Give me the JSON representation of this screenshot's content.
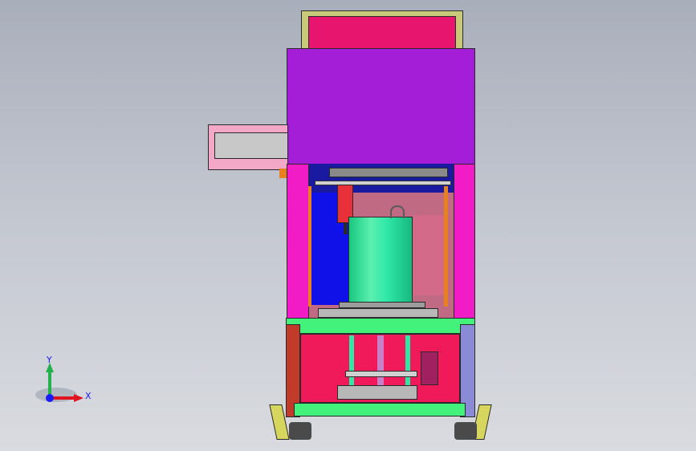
{
  "viewport": {
    "background_top": "#a9aebb",
    "background_bottom": "#d9dbe0"
  },
  "triad": {
    "x_label": "X",
    "y_label": "Y",
    "x_color": "#e0141e",
    "y_color": "#22b14c",
    "z_color": "#1a1aff"
  },
  "model": {
    "colors": {
      "top_box": "#e8156f",
      "hood": "#a31ed6",
      "side_panels": "#f21cc7",
      "inner_blue": "#1010e8",
      "cylinder": "#2ee8a8",
      "base_frame": "#43f27a",
      "lower_red": "#f01a5a",
      "chute": "#c8c8c8",
      "legs": "#d6d65e"
    }
  }
}
